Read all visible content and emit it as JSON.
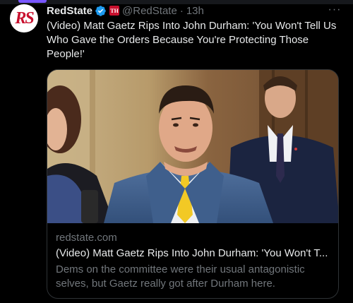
{
  "topbar": {
    "accent_color": "#7856ff"
  },
  "author": {
    "avatar_icon": "redstate-logo-avatar",
    "avatar_text": "RS",
    "name": "RedState",
    "verified_icon": "verified-badge-icon",
    "affiliate_badge_text": "TH",
    "handle": "@RedState",
    "separator": "·",
    "time": "13h"
  },
  "more_icon": "more-options-icon",
  "more_label": "···",
  "tweet": {
    "text": "(Video) Matt Gaetz Rips Into John Durham: 'You Won't Tell Us Who Gave the Orders Because You're Protecting Those People!'"
  },
  "card": {
    "image": "photo-matt-gaetz-at-hearing",
    "domain": "redstate.com",
    "title": "(Video) Matt Gaetz Rips Into John Durham: 'You Won't T...",
    "description": "Dems on the committee were their usual antagonistic selves, but Gaetz really got after Durham here."
  },
  "colors": {
    "background": "#000000",
    "text_primary": "#e7e9ea",
    "text_secondary": "#71767b",
    "verified": "#1d9bf0",
    "border": "#2f3336",
    "brand_red": "#c8102e"
  }
}
